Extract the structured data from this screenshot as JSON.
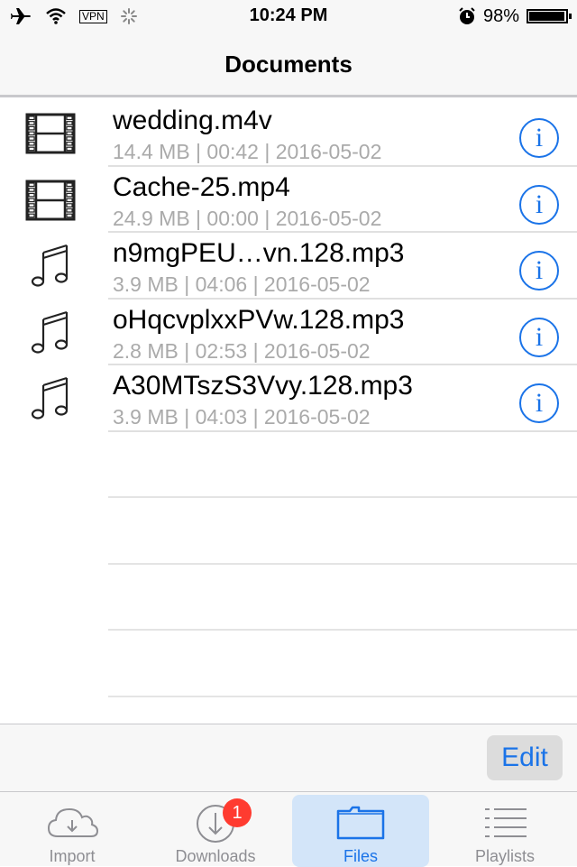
{
  "status_bar": {
    "time": "10:24 PM",
    "vpn_label": "VPN",
    "battery_percent": "98%",
    "battery_level": 0.98,
    "icons": [
      "airplane-icon",
      "wifi-icon",
      "vpn-icon",
      "activity-spinner-icon",
      "alarm-icon",
      "battery-icon"
    ]
  },
  "nav": {
    "title": "Documents"
  },
  "files": [
    {
      "type": "video",
      "icon": "film-icon",
      "name": "wedding.m4v",
      "meta": "14.4 MB | 00:42 | 2016-05-02"
    },
    {
      "type": "video",
      "icon": "film-icon",
      "name": "Cache-25.mp4",
      "meta": "24.9 MB | 00:00 | 2016-05-02"
    },
    {
      "type": "audio",
      "icon": "music-note-icon",
      "name": "n9mgPEU…vn.128.mp3",
      "meta": "3.9 MB | 04:06 | 2016-05-02"
    },
    {
      "type": "audio",
      "icon": "music-note-icon",
      "name": "oHqcvplxxPVw.128.mp3",
      "meta": "2.8 MB | 02:53 | 2016-05-02"
    },
    {
      "type": "audio",
      "icon": "music-note-icon",
      "name": "A30MTszS3Vvy.128.mp3",
      "meta": "3.9 MB | 04:03 | 2016-05-02"
    }
  ],
  "info_glyph": "i",
  "toolbar": {
    "edit_label": "Edit"
  },
  "tabs": [
    {
      "label": "Import",
      "icon": "cloud-download-icon",
      "active": false
    },
    {
      "label": "Downloads",
      "icon": "download-circle-icon",
      "active": false,
      "badge": "1"
    },
    {
      "label": "Files",
      "icon": "folder-icon",
      "active": true
    },
    {
      "label": "Playlists",
      "icon": "list-icon",
      "active": false
    }
  ],
  "colors": {
    "accent": "#1a73e8",
    "badge": "#ff3b30",
    "active_tab_bg": "#d3e5f9",
    "meta_text": "#aaaaaa"
  }
}
